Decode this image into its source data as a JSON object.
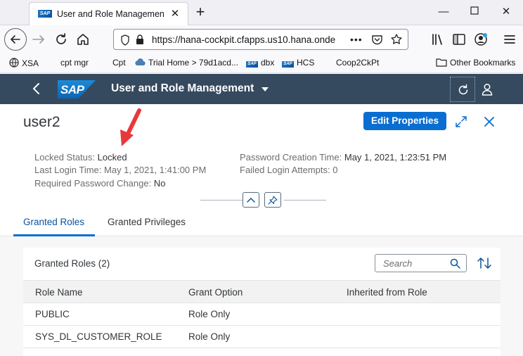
{
  "browser": {
    "tab_title": "User and Role Management – S",
    "url_host": "https://hana-cockpit.cfapps.us10.hana.onde",
    "url_more": "•••"
  },
  "bookmarks": [
    {
      "label": "XSA",
      "icon": "globe-icon"
    },
    {
      "label": "cpt mgr",
      "icon": ""
    },
    {
      "label": "Cpt",
      "icon": ""
    },
    {
      "label": "Trial Home > 79d1acd...",
      "icon": "cloud-icon"
    },
    {
      "label": "dbx",
      "icon": "sap-icon"
    },
    {
      "label": "HCS",
      "icon": "sap-icon"
    },
    {
      "label": "Coop2CkPt",
      "icon": ""
    },
    {
      "label": "Other Bookmarks",
      "icon": "folder-icon"
    }
  ],
  "shell": {
    "logo_text": "SAP",
    "app_title": "User and Role Management"
  },
  "header": {
    "title": "user2",
    "edit_label": "Edit Properties"
  },
  "attributes": {
    "locked_status_label": "Locked Status:",
    "locked_status_value": "Locked",
    "last_login_label": "Last Login Time:",
    "last_login_value": "May 1, 2021, 1:41:00 PM",
    "req_pwd_label": "Required Password Change:",
    "req_pwd_value": "No",
    "pwd_creation_label": "Password Creation Time:",
    "pwd_creation_value": "May 1, 2021, 1:23:51 PM",
    "failed_login_label": "Failed Login Attempts:",
    "failed_login_value": "0"
  },
  "tabs": [
    {
      "label": "Granted Roles",
      "active": true
    },
    {
      "label": "Granted Privileges",
      "active": false
    }
  ],
  "table": {
    "title": "Granted Roles (2)",
    "search_placeholder": "Search",
    "columns": [
      "Role Name",
      "Grant Option",
      "Inherited from Role"
    ],
    "rows": [
      [
        "PUBLIC",
        "Role Only",
        ""
      ],
      [
        "SYS_DL_CUSTOMER_ROLE",
        "Role Only",
        ""
      ]
    ]
  },
  "colors": {
    "shell_bg": "#354a5f",
    "primary_button": "#0a6ed1",
    "active_tab": "#0854a0",
    "annotation_arrow": "#e8393a"
  }
}
